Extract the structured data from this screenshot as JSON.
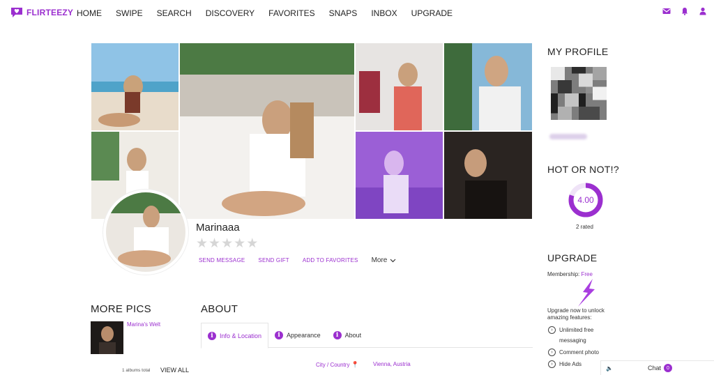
{
  "brand": {
    "name": "FLIRTEEZY",
    "accent": "#9b2fcf"
  },
  "nav": {
    "items": [
      "HOME",
      "SWIPE",
      "SEARCH",
      "DISCOVERY",
      "FAVORITES",
      "SNAPS",
      "INBOX",
      "UPGRADE"
    ]
  },
  "topIcons": [
    "mail-icon",
    "bell-icon",
    "user-icon"
  ],
  "profile": {
    "username": "Marinaaa",
    "rating_stars": 0,
    "rating_max": 5,
    "actions": {
      "send_message": "SEND MESSAGE",
      "send_gift": "SEND GIFT",
      "add_to_favorites": "ADD TO FAVORITES",
      "more": "More"
    }
  },
  "morePics": {
    "title": "MORE PICS",
    "album_name": "Marina's Welt",
    "albums_total": "1 albums total",
    "view_all": "VIEW ALL"
  },
  "about": {
    "title": "ABOUT",
    "tabs": [
      "Info & Location",
      "Appearance",
      "About"
    ],
    "active_tab": 0,
    "city_label": "City / Country",
    "city_value": "Vienna, Austria"
  },
  "sidebar": {
    "my_profile_title": "MY PROFILE",
    "hot_or_not_title": "HOT OR NOT!?",
    "score": "4.00",
    "score_fraction": 0.8,
    "rated": "2 rated",
    "upgrade_title": "UPGRADE",
    "membership_label": "Membership:",
    "membership_value": "Free",
    "upgrade_text": "Upgrade now to unlock amazing features:",
    "features": [
      "Unlimited free messaging",
      "Comment photo",
      "Hide Ads"
    ]
  },
  "chat": {
    "label": "Chat",
    "count": "0"
  }
}
